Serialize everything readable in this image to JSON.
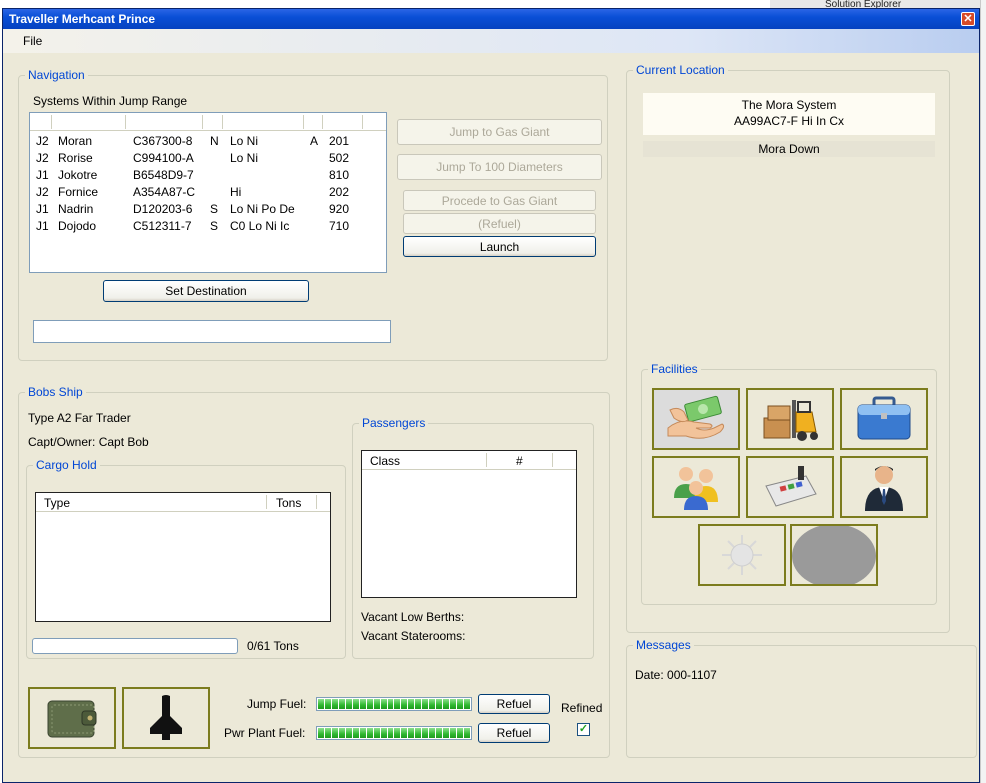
{
  "background": {
    "ide_label": "Solution Explorer"
  },
  "window": {
    "title": "Traveller Merhcant Prince",
    "close_glyph": "✕"
  },
  "menu": {
    "file": "File"
  },
  "navigation": {
    "title": "Navigation",
    "systems_label": "Systems Within Jump Range",
    "rows": [
      {
        "jump": "J2",
        "name": "Moran",
        "uwp": "C367300-8",
        "base": "N",
        "codes": "Lo Ni",
        "zone": "A",
        "pbg": "201"
      },
      {
        "jump": "J2",
        "name": "Rorise",
        "uwp": "C994100-A",
        "base": "",
        "codes": "Lo Ni",
        "zone": "",
        "pbg": "502"
      },
      {
        "jump": "J1",
        "name": "Jokotre",
        "uwp": "B6548D9-7",
        "base": "",
        "codes": "",
        "zone": "",
        "pbg": "810"
      },
      {
        "jump": "J2",
        "name": "Fornice",
        "uwp": "A354A87-C",
        "base": "",
        "codes": "Hi",
        "zone": "",
        "pbg": "202"
      },
      {
        "jump": "J1",
        "name": "Nadrin",
        "uwp": "D120203-6",
        "base": "S",
        "codes": "Lo Ni Po De",
        "zone": "",
        "pbg": "920"
      },
      {
        "jump": "J1",
        "name": "Dojodo",
        "uwp": "C512311-7",
        "base": "S",
        "codes": "C0 Lo Ni Ic",
        "zone": "",
        "pbg": "710"
      }
    ],
    "set_destination": "Set Destination",
    "jump_gas_giant": "Jump to Gas Giant",
    "jump_100": "Jump To 100 Diameters",
    "procede_gas_giant": "Procede to Gas Giant",
    "refuel": "(Refuel)",
    "launch": "Launch"
  },
  "location": {
    "title": "Current Location",
    "system": "The Mora System",
    "uwp": "AA99AC7-F Hi In Cx",
    "port": "Mora Down"
  },
  "facilities": {
    "title": "Facilities",
    "icons": [
      "money-exchange-icon",
      "cargo-forklift-icon",
      "briefcase-icon",
      "people-group-icon",
      "trade-terminal-icon",
      "businessman-icon",
      "sun-icon",
      "gray-disc-icon"
    ]
  },
  "ship": {
    "title": "Bobs Ship",
    "type": "Type A2 Far Trader",
    "owner": "Capt/Owner: Capt Bob",
    "cargo": {
      "title": "Cargo Hold",
      "col_type": "Type",
      "col_tons": "Tons",
      "capacity": "0/61 Tons",
      "fill": 0
    },
    "passengers": {
      "title": "Passengers",
      "col_class": "Class",
      "col_count": "#",
      "low_berths": "Vacant Low Berths:",
      "staterooms": "Vacant Staterooms:"
    },
    "jump_fuel_label": "Jump Fuel:",
    "pwr_fuel_label": "Pwr Plant Fuel:",
    "jump_fuel_level": 1.0,
    "pwr_fuel_level": 1.0,
    "refuel": "Refuel",
    "refined": "Refined",
    "refined_checked": true,
    "icons": [
      "wallet-icon",
      "ship-silhouette-icon"
    ]
  },
  "messages": {
    "title": "Messages",
    "date": "Date: 000-1107"
  }
}
